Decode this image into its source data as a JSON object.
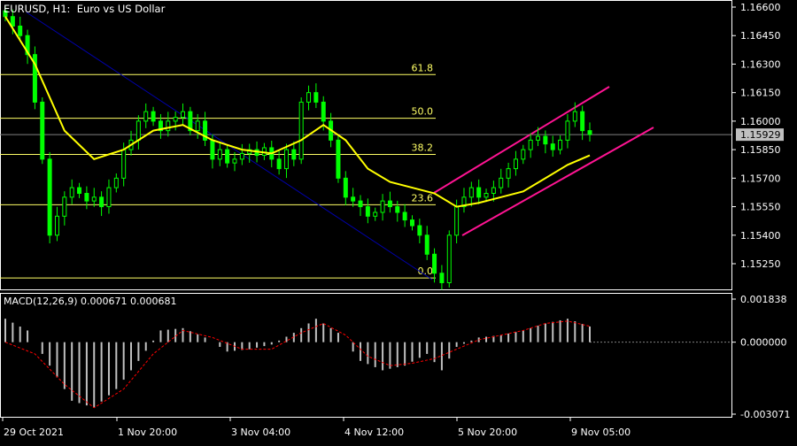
{
  "header": {
    "symbol": "EURUSD",
    "timeframe": "H1",
    "description": "Euro vs US Dollar",
    "title_text": "EURUSD, H1:  Euro vs US Dollar"
  },
  "price_panel": {
    "price_labels": [
      "1.16600",
      "1.16450",
      "1.16300",
      "1.16150",
      "1.16000",
      "1.15850",
      "1.15700",
      "1.15550",
      "1.15400",
      "1.15250"
    ],
    "price_values": [
      1.166,
      1.1645,
      1.163,
      1.1615,
      1.16,
      1.1585,
      1.157,
      1.1555,
      1.154,
      1.1525
    ],
    "current_price_label": "1.15929",
    "current_price": 1.15929,
    "fib_levels": [
      {
        "label": "61.8",
        "price": 1.16245
      },
      {
        "label": "50.0",
        "price": 1.16015
      },
      {
        "label": "38.2",
        "price": 1.15825
      },
      {
        "label": "23.6",
        "price": 1.1556
      },
      {
        "label": "0.0",
        "price": 1.15175
      }
    ]
  },
  "macd_panel": {
    "label": "MACD(12,26,9) 0.000671 0.000681",
    "scale_labels": [
      "0.001838",
      "0.000000",
      "-0.003071"
    ],
    "scale_values": [
      0.001838,
      0.0,
      -0.003071
    ]
  },
  "time_labels": [
    "29 Oct 2021",
    "1 Nov 20:00",
    "3 Nov 04:00",
    "4 Nov 12:00",
    "5 Nov 20:00",
    "9 Nov 05:00"
  ],
  "colors": {
    "background": "#000000",
    "candles": "#00ff00",
    "moving_average": "#ffff00",
    "fibonacci": "#ffff66",
    "down_trendline": "#0000aa",
    "channel": "#ff1493",
    "macd_histogram": "#c0c0c0",
    "macd_signal": "#ff0000",
    "grid_lines": "#808080"
  },
  "chart_data": {
    "type": "candlestick",
    "title": "EURUSD, H1:  Euro vs US Dollar",
    "ylim": [
      1.1515,
      1.1665
    ],
    "x_tick_labels": [
      "29 Oct 2021",
      "1 Nov 20:00",
      "3 Nov 04:00",
      "4 Nov 12:00",
      "5 Nov 20:00",
      "9 Nov 05:00"
    ],
    "close_path": [
      [
        0,
        1.1655
      ],
      [
        1,
        1.165
      ],
      [
        2,
        1.1645
      ],
      [
        3,
        1.1635
      ],
      [
        4,
        1.161
      ],
      [
        5,
        1.158
      ],
      [
        6,
        1.154
      ],
      [
        7,
        1.155
      ],
      [
        8,
        1.156
      ],
      [
        9,
        1.1565
      ],
      [
        10,
        1.1562
      ],
      [
        11,
        1.1558
      ],
      [
        12,
        1.156
      ],
      [
        13,
        1.1555
      ],
      [
        14,
        1.1565
      ],
      [
        15,
        1.157
      ],
      [
        16,
        1.1585
      ],
      [
        17,
        1.159
      ],
      [
        18,
        1.16
      ],
      [
        19,
        1.1605
      ],
      [
        20,
        1.16
      ],
      [
        21,
        1.1595
      ],
      [
        22,
        1.16
      ],
      [
        23,
        1.1602
      ],
      [
        24,
        1.1605
      ],
      [
        25,
        1.1595
      ],
      [
        26,
        1.16
      ],
      [
        27,
        1.159
      ],
      [
        28,
        1.158
      ],
      [
        29,
        1.1585
      ],
      [
        30,
        1.1578
      ],
      [
        31,
        1.158
      ],
      [
        32,
        1.1583
      ],
      [
        33,
        1.1585
      ],
      [
        34,
        1.1582
      ],
      [
        35,
        1.1586
      ],
      [
        36,
        1.158
      ],
      [
        37,
        1.1575
      ],
      [
        38,
        1.1585
      ],
      [
        39,
        1.158
      ],
      [
        40,
        1.161
      ],
      [
        41,
        1.1615
      ],
      [
        42,
        1.161
      ],
      [
        43,
        1.16
      ],
      [
        44,
        1.159
      ],
      [
        45,
        1.157
      ],
      [
        46,
        1.156
      ],
      [
        47,
        1.1558
      ],
      [
        48,
        1.1555
      ],
      [
        49,
        1.155
      ],
      [
        50,
        1.1552
      ],
      [
        51,
        1.1558
      ],
      [
        52,
        1.1555
      ],
      [
        53,
        1.1552
      ],
      [
        54,
        1.1548
      ],
      [
        55,
        1.1545
      ],
      [
        56,
        1.154
      ],
      [
        57,
        1.153
      ],
      [
        58,
        1.152
      ],
      [
        59,
        1.1515
      ],
      [
        60,
        1.154
      ],
      [
        61,
        1.1555
      ],
      [
        62,
        1.156
      ],
      [
        63,
        1.1565
      ],
      [
        64,
        1.156
      ],
      [
        65,
        1.1562
      ],
      [
        66,
        1.1565
      ],
      [
        67,
        1.157
      ],
      [
        68,
        1.1575
      ],
      [
        69,
        1.158
      ],
      [
        70,
        1.1585
      ],
      [
        71,
        1.159
      ],
      [
        72,
        1.1592
      ],
      [
        73,
        1.1588
      ],
      [
        74,
        1.1585
      ],
      [
        75,
        1.159
      ],
      [
        76,
        1.16
      ],
      [
        77,
        1.1605
      ],
      [
        78,
        1.1595
      ],
      [
        79,
        1.1593
      ]
    ],
    "moving_average": [
      [
        0,
        1.1655
      ],
      [
        4,
        1.163
      ],
      [
        8,
        1.1595
      ],
      [
        12,
        1.158
      ],
      [
        16,
        1.1585
      ],
      [
        20,
        1.1595
      ],
      [
        24,
        1.1598
      ],
      [
        28,
        1.159
      ],
      [
        32,
        1.1585
      ],
      [
        36,
        1.1583
      ],
      [
        40,
        1.159
      ],
      [
        43,
        1.1598
      ],
      [
        46,
        1.159
      ],
      [
        49,
        1.1575
      ],
      [
        52,
        1.1568
      ],
      [
        55,
        1.1565
      ],
      [
        58,
        1.1562
      ],
      [
        61,
        1.1555
      ],
      [
        64,
        1.1557
      ],
      [
        67,
        1.156
      ],
      [
        70,
        1.1563
      ],
      [
        73,
        1.157
      ],
      [
        76,
        1.1577
      ],
      [
        79,
        1.1582
      ]
    ],
    "macd_histogram": [
      [
        0,
        0.001
      ],
      [
        3,
        0.0005
      ],
      [
        6,
        -0.001
      ],
      [
        9,
        -0.0025
      ],
      [
        12,
        -0.0028
      ],
      [
        15,
        -0.002
      ],
      [
        18,
        -0.0008
      ],
      [
        21,
        0.0005
      ],
      [
        24,
        0.0006
      ],
      [
        27,
        0.0002
      ],
      [
        30,
        -0.0004
      ],
      [
        33,
        -0.0003
      ],
      [
        36,
        -0.0001
      ],
      [
        39,
        0.0004
      ],
      [
        42,
        0.001
      ],
      [
        45,
        0.0004
      ],
      [
        48,
        -0.0008
      ],
      [
        51,
        -0.0012
      ],
      [
        54,
        -0.001
      ],
      [
        57,
        -0.0005
      ],
      [
        59,
        -0.0012
      ],
      [
        61,
        -0.0002
      ],
      [
        64,
        0.0002
      ],
      [
        67,
        0.0003
      ],
      [
        70,
        0.0005
      ],
      [
        73,
        0.0008
      ],
      [
        76,
        0.001
      ],
      [
        79,
        0.00067
      ]
    ],
    "macd_signal": [
      [
        0,
        0.0
      ],
      [
        4,
        -0.0005
      ],
      [
        8,
        -0.0018
      ],
      [
        12,
        -0.0028
      ],
      [
        16,
        -0.002
      ],
      [
        20,
        -0.0005
      ],
      [
        24,
        0.0005
      ],
      [
        28,
        0.0002
      ],
      [
        32,
        -0.0003
      ],
      [
        36,
        -0.0003
      ],
      [
        40,
        0.0004
      ],
      [
        43,
        0.0008
      ],
      [
        46,
        0.0003
      ],
      [
        49,
        -0.0006
      ],
      [
        52,
        -0.001
      ],
      [
        55,
        -0.0009
      ],
      [
        58,
        -0.0007
      ],
      [
        61,
        -0.0003
      ],
      [
        64,
        0.0001
      ],
      [
        67,
        0.0003
      ],
      [
        70,
        0.0005
      ],
      [
        73,
        0.0008
      ],
      [
        76,
        0.0009
      ],
      [
        79,
        0.00068
      ]
    ]
  }
}
